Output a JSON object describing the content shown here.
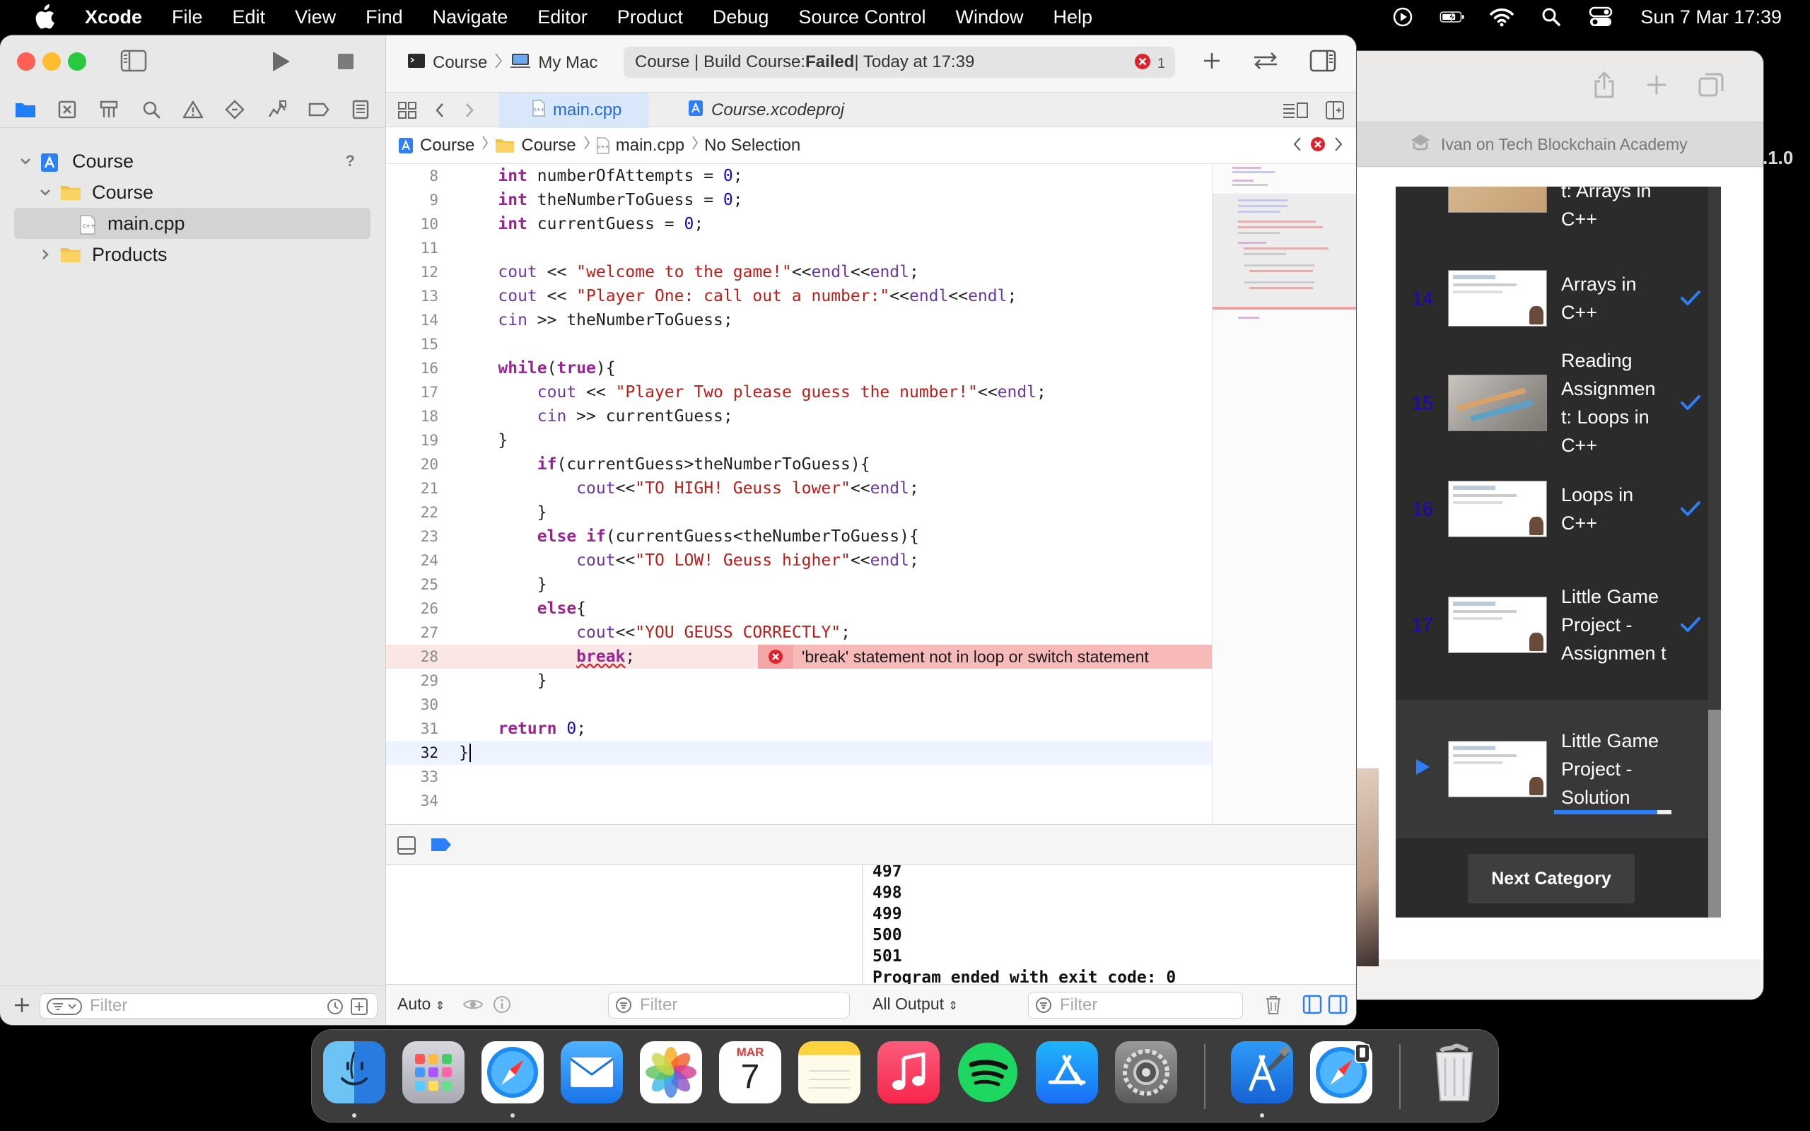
{
  "menubar": {
    "app": "Xcode",
    "items": [
      "File",
      "Edit",
      "View",
      "Find",
      "Navigate",
      "Editor",
      "Product",
      "Debug",
      "Source Control",
      "Window",
      "Help"
    ],
    "clock": "Sun 7 Mar  17:39"
  },
  "xcode": {
    "scheme": {
      "target": "Course",
      "destination": "My Mac"
    },
    "activity": {
      "prefix": "Course | Build Course: ",
      "status": "Failed",
      "suffix": " | Today at 17:39",
      "error_count": "1"
    },
    "tabs": {
      "active": "main.cpp",
      "inactive": "Course.xcodeproj"
    },
    "jumpbar": {
      "project": "Course",
      "group": "Course",
      "file": "main.cpp",
      "selection": "No Selection"
    },
    "navigator": {
      "project": "Course",
      "help": "?",
      "group": "Course",
      "file": "main.cpp",
      "products": "Products",
      "filter_placeholder": "Filter"
    },
    "error_message": "'break' statement not in loop or switch statement",
    "line_numbers": [
      "8",
      "9",
      "10",
      "11",
      "12",
      "13",
      "14",
      "15",
      "16",
      "17",
      "18",
      "19",
      "20",
      "21",
      "22",
      "23",
      "24",
      "25",
      "26",
      "27",
      "28",
      "29",
      "30",
      "31",
      "32",
      "33",
      "34"
    ],
    "code": {
      "l8_var": "numberOfAttempts = ",
      "l8_val": "0",
      "l9_var": "theNumberToGuess = ",
      "l9_val": "0",
      "l10_var": "currentGuess = ",
      "l10_val": "0",
      "l12_str": "\"welcome to the game!\"",
      "l13_str": "\"Player One: call out a number:\"",
      "l14_rest": " >> theNumberToGuess;",
      "l17_str": "\"Player Two please guess the number!\"",
      "l18_rest": " >> currentGuess;",
      "l20_rest": "(currentGuess>theNumberToGuess){",
      "l21_str": "\"TO HIGH! Geuss lower\"",
      "l23_rest": "(currentGuess<theNumberToGuess){",
      "l24_str": "\"TO LOW! Geuss higher\"",
      "l27_str": "\"YOU GEUSS CORRECTLY\"",
      "l31_val": "0",
      "kw_int": "int",
      "kw_while": "while",
      "kw_true": "true",
      "kw_if": "if",
      "kw_else": "else",
      "kw_break": "break",
      "kw_return": "return",
      "cout": "cout",
      "cin": "cin",
      "endl": "endl"
    },
    "console": [
      "497",
      "498",
      "499",
      "500",
      "501",
      "Program ended with exit code: 0"
    ],
    "bottom": {
      "auto": "Auto",
      "output": "All Output",
      "filter_placeholder": "Filter"
    }
  },
  "browser": {
    "tab_title": "Ivan on Tech Blockchain Academy",
    "version_fragment": ".1.0",
    "lessons": [
      {
        "num": "",
        "title": "t: Arrays in C++",
        "done": false
      },
      {
        "num": "14",
        "title": "Arrays in C++",
        "done": true
      },
      {
        "num": "15",
        "title": "Reading Assignmen t: Loops in C++",
        "done": true
      },
      {
        "num": "16",
        "title": "Loops in C++",
        "done": true
      },
      {
        "num": "17",
        "title": "Little Game Project - Assignmen t",
        "done": true
      },
      {
        "num": "",
        "title": "Little Game Project - Solution",
        "done": false,
        "playing": true,
        "progress": 0.88
      }
    ],
    "next_category": "Next Category"
  },
  "dock": {
    "apps": [
      "finder",
      "launchpad",
      "safari",
      "mail",
      "photos",
      "calendar",
      "notes",
      "music",
      "spotify",
      "app-store",
      "system-preferences",
      "xcode",
      "safari-2",
      "trash"
    ],
    "calendar_month": "MAR",
    "calendar_day": "7"
  },
  "colors": {
    "accent": "#2d7ff9",
    "error": "#e0232a",
    "keyword": "#9b2393",
    "string": "#c41a16",
    "number": "#1c00cf",
    "function": "#6c36a9"
  }
}
